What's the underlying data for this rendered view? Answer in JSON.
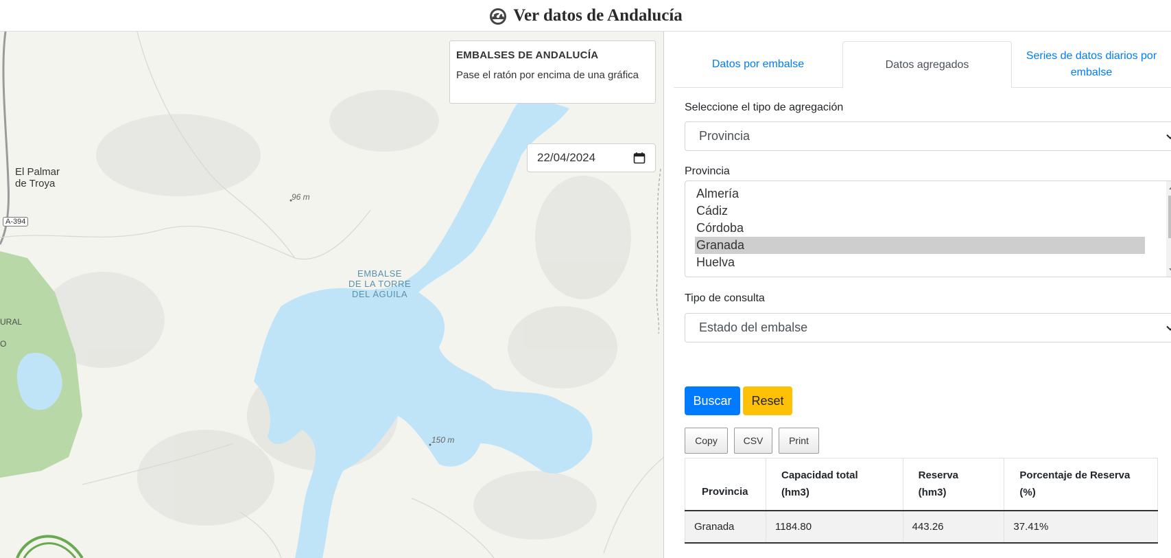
{
  "header": {
    "title": "Ver datos de Andalucía",
    "icon": "tachometer-icon"
  },
  "map": {
    "info_box": {
      "title": "EMBALSES DE ANDALUCÍA",
      "hint": "Pase el ratón por encima de una gráfica"
    },
    "date_value": "22/04/2024",
    "labels": {
      "town": "El Palmar de Troya",
      "town_line1": "El Palmar",
      "town_line2": "de Troya",
      "road": "A-394",
      "reservoir_line1": "EMBALSE",
      "reservoir_line2": "DE LA TORRE",
      "reservoir_line3": "DEL ÁGUILA",
      "elev_1": "96 m",
      "elev_2": "150 m",
      "edge_1": "URAL",
      "edge_2": "O"
    },
    "colors": {
      "water": "#bfe4f7",
      "forest": "#b8d8a8",
      "land": "#f4f4ef"
    }
  },
  "tabs": [
    {
      "label": "Datos por embalse",
      "active": false
    },
    {
      "label": "Datos agregados",
      "active": true
    },
    {
      "label": "Series de datos diarios por embalse",
      "active": false
    }
  ],
  "form": {
    "aggregation_label": "Seleccione el tipo de agregación",
    "aggregation_value": "Provincia",
    "province_label": "Provincia",
    "provinces": [
      "Almería",
      "Cádiz",
      "Córdoba",
      "Granada",
      "Huelva"
    ],
    "selected_province": "Granada",
    "query_label": "Tipo de consulta",
    "query_value": "Estado del embalse",
    "buscar_label": "Buscar",
    "reset_label": "Reset"
  },
  "export_buttons": {
    "copy": "Copy",
    "csv": "CSV",
    "print": "Print"
  },
  "table": {
    "headers": [
      "Provincia",
      "Capacidad total (hm3)",
      "Reserva (hm3)",
      "Porcentaje de Reserva (%)"
    ],
    "rows": [
      [
        "Granada",
        "1184.80",
        "443.26",
        "37.41%"
      ]
    ]
  },
  "colors": {
    "primary": "#007bff",
    "warning": "#ffc107"
  }
}
